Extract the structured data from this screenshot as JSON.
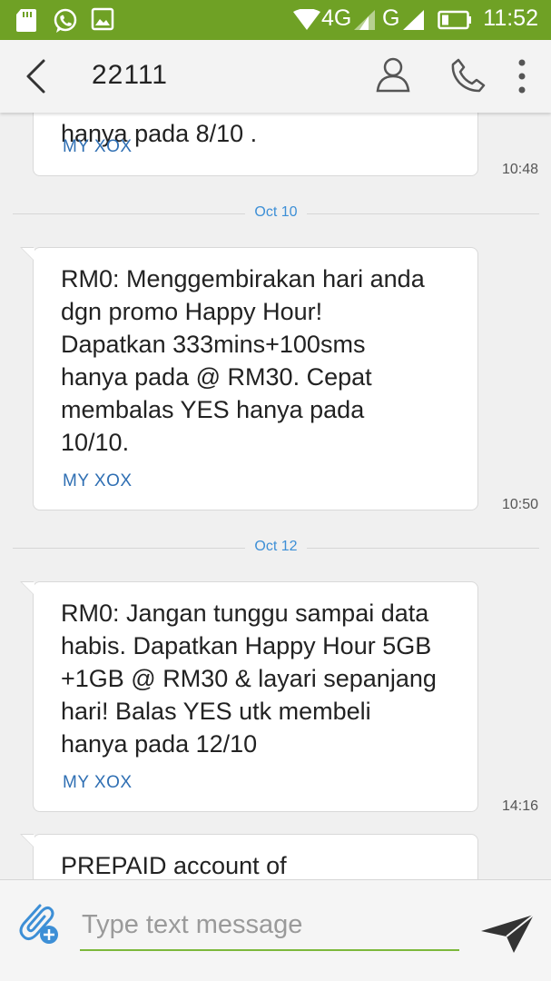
{
  "status_bar": {
    "network": "4G",
    "network2": "G",
    "time": "11:52",
    "bg_color": "#6fa125"
  },
  "header": {
    "title": "22111",
    "icons": [
      "back-arrow-icon",
      "contact-icon",
      "phone-icon",
      "more-vert-icon"
    ]
  },
  "messages": [
    {
      "body": "hanya pada 8/10 .",
      "sender": "MY XOX",
      "time": "10:48"
    },
    {
      "date": "Oct 10",
      "body": "RM0: Menggembirakan hari anda\ndgn promo Happy Hour!\nDapatkan 333mins+100sms\nhanya pada @ RM30. Cepat\nmembalas YES hanya pada\n10/10.",
      "sender": "MY XOX",
      "time": "10:50"
    },
    {
      "date": "Oct 12",
      "body": "RM0: Jangan tunggu sampai data\nhabis. Dapatkan Happy Hour 5GB\n+1GB @ RM30 & layari sepanjang\nhari! Balas YES utk membeli\nhanya pada 12/10",
      "sender": "MY XOX",
      "time": "14:16"
    },
    {
      "body": "PREPAID account of"
    }
  ],
  "compose": {
    "placeholder": "Type text message",
    "accent_color": "#7cb83b"
  }
}
